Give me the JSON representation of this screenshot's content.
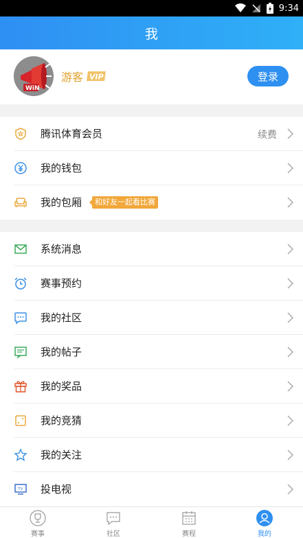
{
  "status_bar": {
    "time": "9:34"
  },
  "header": {
    "title": "我"
  },
  "profile": {
    "name": "游客",
    "login_label": "登录"
  },
  "group1": [
    {
      "id": "tencent-sports-member",
      "icon": "medal-icon",
      "label": "腾讯体育会员",
      "extra": "续费"
    },
    {
      "id": "wallet",
      "icon": "yen-icon",
      "label": "我的钱包"
    },
    {
      "id": "private-box",
      "icon": "sofa-icon",
      "label": "我的包厢",
      "tag": "和好友一起看比赛"
    }
  ],
  "group2": [
    {
      "id": "system-messages",
      "icon": "mail-icon",
      "label": "系统消息"
    },
    {
      "id": "match-reservations",
      "icon": "alarm-clock-icon",
      "label": "赛事预约"
    },
    {
      "id": "my-community",
      "icon": "chat-bubble-icon",
      "label": "我的社区"
    },
    {
      "id": "my-posts",
      "icon": "post-icon",
      "label": "我的帖子"
    },
    {
      "id": "my-prizes",
      "icon": "gift-icon",
      "label": "我的奖品"
    },
    {
      "id": "my-guesses",
      "icon": "dice-icon",
      "label": "我的竞猜"
    },
    {
      "id": "my-follows",
      "icon": "star-icon",
      "label": "我的关注"
    },
    {
      "id": "cast-to-tv",
      "icon": "tv-icon",
      "label": "投电视"
    }
  ],
  "tabs": [
    {
      "id": "matches",
      "icon": "trophy-icon",
      "label": "赛事"
    },
    {
      "id": "community",
      "icon": "chat-bubble-icon",
      "label": "社区"
    },
    {
      "id": "schedule",
      "icon": "calendar-icon",
      "label": "赛程"
    },
    {
      "id": "me",
      "icon": "person-icon",
      "label": "我的",
      "active": true
    }
  ],
  "colors": {
    "header": "#2f8ff3",
    "accent": "#2e90f0",
    "vip_gold": "#e1a12e",
    "tag": "#f1a73a"
  }
}
